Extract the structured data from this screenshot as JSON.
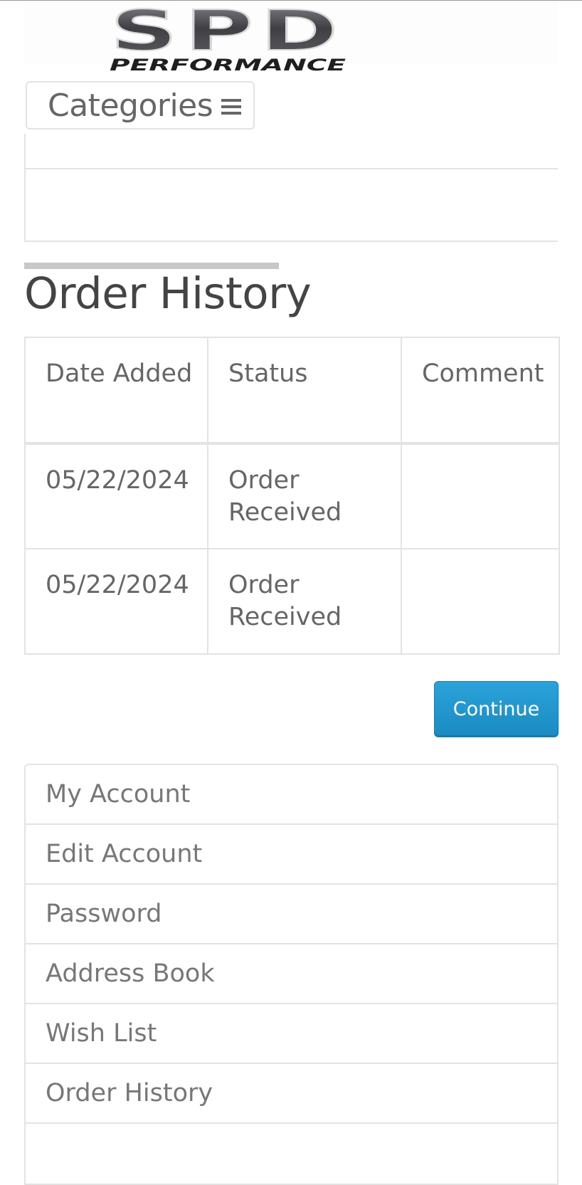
{
  "header": {
    "logo_text": "SPD",
    "logo_subtext": "PERFORMANCE"
  },
  "nav": {
    "categories_label": "Categories"
  },
  "page": {
    "title": "Order History"
  },
  "history_table": {
    "columns": [
      "Date Added",
      "Status",
      "Comment"
    ],
    "rows": [
      {
        "date": "05/22/2024",
        "status": "Order Received",
        "comment": ""
      },
      {
        "date": "05/22/2024",
        "status": "Order Received",
        "comment": ""
      }
    ]
  },
  "actions": {
    "continue_label": "Continue"
  },
  "account_menu": {
    "items": [
      {
        "label": "My Account"
      },
      {
        "label": "Edit Account"
      },
      {
        "label": "Password"
      },
      {
        "label": "Address Book"
      },
      {
        "label": "Wish List"
      },
      {
        "label": "Order History"
      },
      {
        "label": ""
      }
    ]
  },
  "colors": {
    "accent": "#1b8ac2",
    "border": "#e3e3e3",
    "text": "#666666"
  }
}
